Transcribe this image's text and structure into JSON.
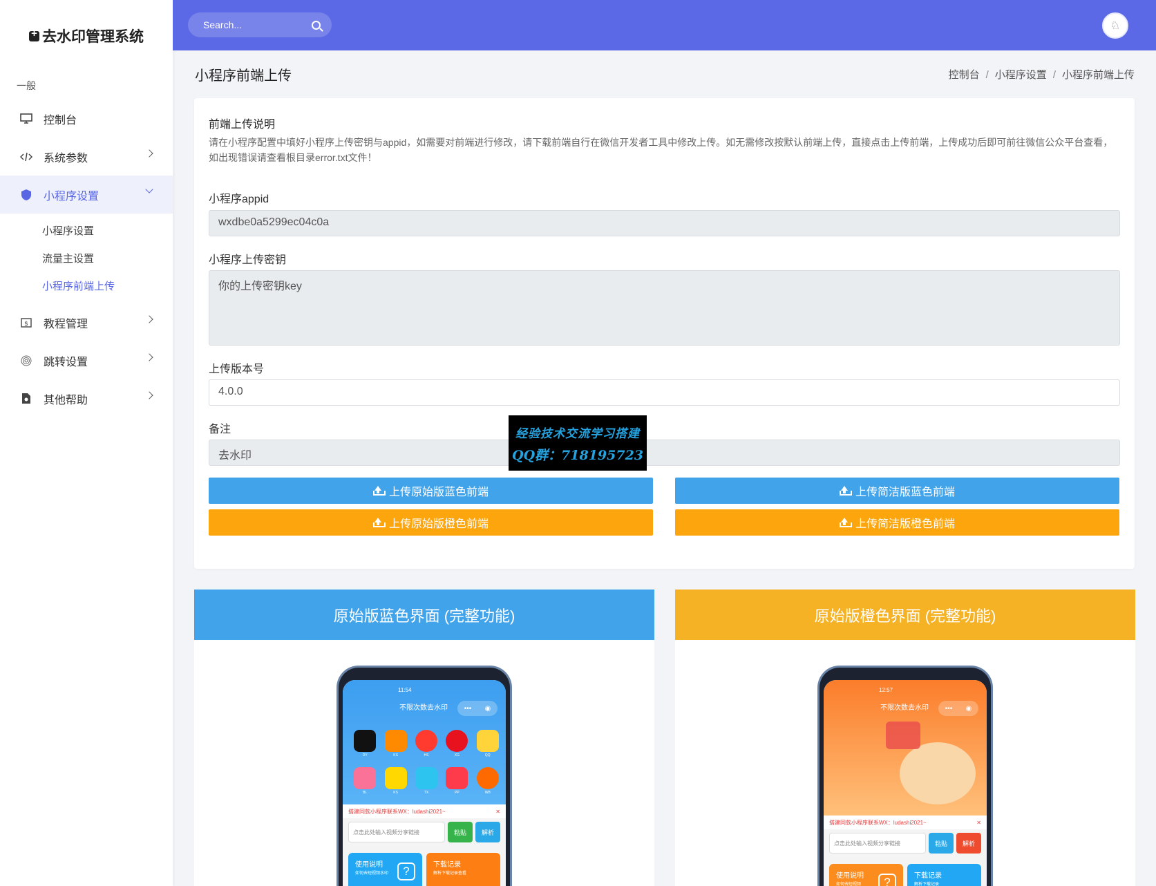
{
  "app": {
    "name": "去水印管理系统"
  },
  "sidebar": {
    "section": "一般",
    "items": [
      {
        "label": "控制台"
      },
      {
        "label": "系统参数"
      },
      {
        "label": "小程序设置"
      },
      {
        "label": "教程管理"
      },
      {
        "label": "跳转设置"
      },
      {
        "label": "其他帮助"
      }
    ],
    "sub_items": [
      {
        "label": "小程序设置"
      },
      {
        "label": "流量主设置"
      },
      {
        "label": "小程序前端上传"
      }
    ]
  },
  "topbar": {
    "search_placeholder": "Search..."
  },
  "page": {
    "title": "小程序前端上传",
    "breadcrumb": [
      "控制台",
      "小程序设置",
      "小程序前端上传"
    ]
  },
  "form": {
    "note_title": "前端上传说明",
    "note_text": "请在小程序配置中填好小程序上传密钥与appid，如需要对前端进行修改，请下载前端自行在微信开发者工具中修改上传。如无需修改按默认前端上传，直接点击上传前端，上传成功后即可前往微信公众平台查看，如出现错误请查看根目录error.txt文件！",
    "appid_label": "小程序appid",
    "appid_value": "wxdbe0a5299ec04c0a",
    "key_label": "小程序上传密钥",
    "key_value": "你的上传密钥key",
    "version_label": "上传版本号",
    "version_value": "4.0.0",
    "remark_label": "备注",
    "remark_value": "去水印",
    "btn_orig_blue": "上传原始版蓝色前端",
    "btn_simple_blue": "上传简洁版蓝色前端",
    "btn_orig_orange": "上传原始版橙色前端",
    "btn_simple_orange": "上传简洁版橙色前端"
  },
  "watermark": {
    "line1": "经验技术交流学习搭建",
    "line2": "QQ群：718195723"
  },
  "previews": [
    {
      "title": "原始版蓝色界面 (完整功能)",
      "color": "#41a3ea",
      "time": "11:54",
      "app_title": "不限次数去水印",
      "apps": [
        "DY",
        "KS",
        "HS",
        "XG",
        "QQ",
        "BL",
        "KS",
        "TX",
        "PP",
        "WB"
      ],
      "notice": "搭建同款小程序联系WX：ludashi2021~",
      "input_placeholder": "点击此处输入视频分享链接",
      "paste": "粘贴",
      "parse": "解析",
      "tile1": "使用说明",
      "tile1_sub": "如何去短视频水印",
      "tile2": "下载记录",
      "tile2_sub": "解析下载记录查看"
    },
    {
      "title": "原始版橙色界面 (完整功能)",
      "color": "#f4b224",
      "time": "12:57",
      "app_title": "不限次数去水印",
      "notice": "搭建同款小程序联系WX：ludashi2021~",
      "input_placeholder": "点击此处输入视频分享链接",
      "paste": "粘贴",
      "parse": "解析",
      "tile1": "使用说明",
      "tile1_sub": "如何去短视频",
      "tile2": "下载记录",
      "tile2_sub": "解析下载记录"
    }
  ],
  "colors": {
    "primary": "#5b69e6",
    "blue": "#41a3ea",
    "orange": "#fca50c"
  }
}
